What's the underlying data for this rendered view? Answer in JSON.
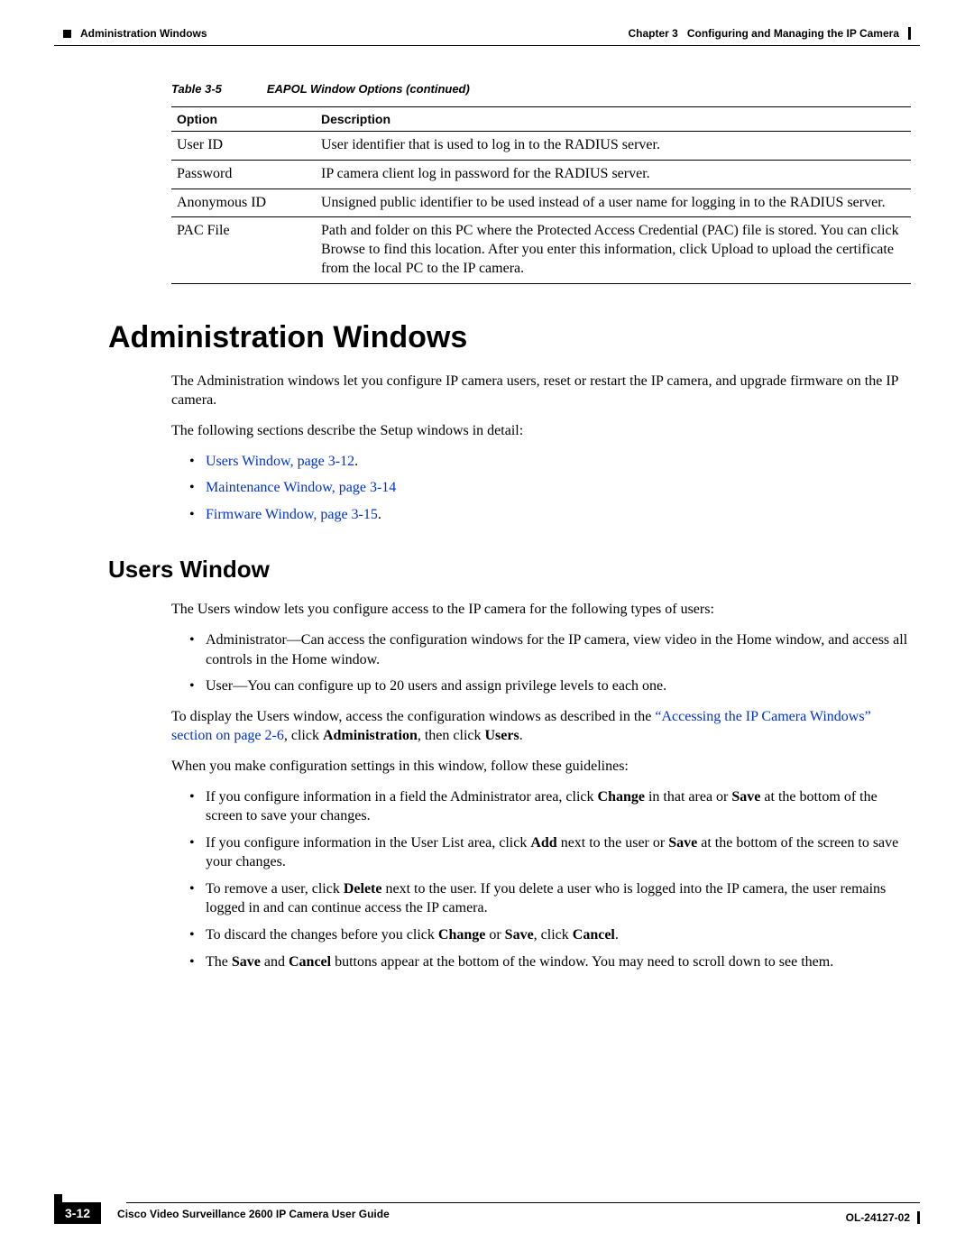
{
  "header": {
    "section_name": "Administration Windows",
    "chapter_label": "Chapter 3",
    "chapter_title": "Configuring and Managing the IP Camera"
  },
  "table": {
    "caption_label": "Table 3-5",
    "caption_title": "EAPOL Window Options (continued)",
    "headers": {
      "col1": "Option",
      "col2": "Description"
    },
    "rows": [
      {
        "option": "User ID",
        "description": "User identifier that is used to log in to the RADIUS server."
      },
      {
        "option": "Password",
        "description": "IP camera client log in password for the RADIUS server."
      },
      {
        "option": "Anonymous ID",
        "description": "Unsigned public identifier to be used instead of a user name for logging in to the RADIUS server."
      },
      {
        "option": "PAC File",
        "description": "Path and folder on this PC where the Protected Access Credential (PAC) file is stored. You can click Browse to find this location. After you enter this information, click Upload to upload the certificate from the local PC to the IP camera."
      }
    ]
  },
  "section": {
    "title": "Administration Windows",
    "intro1": "The Administration windows let you configure IP camera users, reset or restart the IP camera, and upgrade firmware on the IP camera.",
    "intro2": "The following sections describe the Setup windows in detail:",
    "links": [
      "Users Window, page 3-12",
      "Maintenance Window, page 3-14",
      "Firmware Window, page 3-15"
    ]
  },
  "subsection": {
    "title": "Users Window",
    "p1": "The Users window lets you configure access to the IP camera for the following types of users:",
    "bullets1": [
      "Administrator—Can access the configuration windows for the IP camera, view video in the Home window, and access all controls in the Home window.",
      "User—You can configure up to 20 users and assign privilege levels to each one."
    ],
    "p2a": "To display the Users window, access the configuration windows as described in the ",
    "p2link": "“Accessing the IP Camera Windows” section on page 2-6",
    "p2b": ", click ",
    "p2bold1": "Administration",
    "p2c": ", then click ",
    "p2bold2": "Users",
    "p2d": ".",
    "p3": "When you make configuration settings in this window, follow these guidelines:",
    "bullets2": {
      "b1a": "If you configure information in a field the Administrator area, click ",
      "b1bold1": "Change",
      "b1b": " in that area or ",
      "b1bold2": "Save",
      "b1c": " at the bottom of the screen to save your changes.",
      "b2a": "If you configure information in the User List area, click ",
      "b2bold1": "Add",
      "b2b": " next to the user or ",
      "b2bold2": "Save",
      "b2c": " at the bottom of the screen to save your changes.",
      "b3a": "To remove a user, click ",
      "b3bold1": "Delete",
      "b3b": " next to the user. If you delete a user who is logged into the IP camera, the user remains logged in and can continue access the IP camera.",
      "b4a": "To discard the changes before you click ",
      "b4bold1": "Change",
      "b4b": " or ",
      "b4bold2": "Save",
      "b4c": ", click ",
      "b4bold3": "Cancel",
      "b4d": ".",
      "b5a": "The ",
      "b5bold1": "Save",
      "b5b": " and ",
      "b5bold2": "Cancel",
      "b5c": " buttons appear at the bottom of the window. You may need to scroll down to see them."
    }
  },
  "footer": {
    "guide_title": "Cisco Video Surveillance 2600 IP Camera User Guide",
    "page_number": "3-12",
    "doc_id": "OL-24127-02"
  }
}
